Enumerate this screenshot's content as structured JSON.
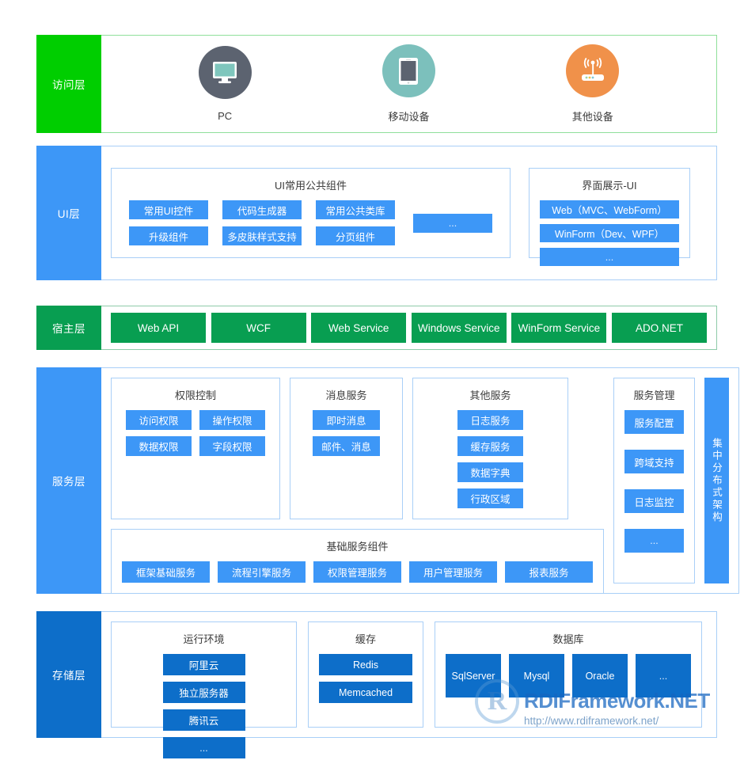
{
  "layers": {
    "access": {
      "label": "访问层",
      "color": "#00ce00",
      "devices": [
        {
          "name": "PC",
          "icon": "desktop-monitor-icon",
          "circle_color": "#5c6370",
          "glyph_color": "#7fc6bd"
        },
        {
          "name": "移动设备",
          "icon": "tablet-device-icon",
          "circle_color": "#7cc0bc",
          "glyph_color": "#5c6370"
        },
        {
          "name": "其他设备",
          "icon": "wireless-router-icon",
          "circle_color": "#f0914a",
          "glyph_color": "#ffffff"
        }
      ]
    },
    "ui": {
      "label": "UI层",
      "color": "#3d97f7",
      "common": {
        "title": "UI常用公共组件",
        "chips": [
          "常用UI控件",
          "代码生成器",
          "常用公共类库",
          "升级组件",
          "多皮肤样式支持",
          "分页组件"
        ],
        "more": "..."
      },
      "display": {
        "title": "界面展示-UI",
        "chips": [
          "Web（MVC、WebForm）",
          "WinForm（Dev、WPF）",
          "..."
        ]
      }
    },
    "host": {
      "label": "宿主层",
      "color": "#089e51",
      "chips": [
        "Web API",
        "WCF",
        "Web Service",
        "Windows Service",
        "WinForm Service",
        "ADO.NET"
      ]
    },
    "service": {
      "label": "服务层",
      "color": "#3d97f7",
      "permission": {
        "title": "权限控制",
        "chips": [
          "访问权限",
          "操作权限",
          "数据权限",
          "字段权限"
        ]
      },
      "message": {
        "title": "消息服务",
        "chips": [
          "即时消息",
          "邮件、消息"
        ]
      },
      "other": {
        "title": "其他服务",
        "chips": [
          "日志服务",
          "缓存服务",
          "数据字典",
          "行政区域"
        ]
      },
      "base": {
        "title": "基础服务组件",
        "chips": [
          "框架基础服务",
          "流程引擎服务",
          "权限管理服务",
          "用户管理服务",
          "报表服务"
        ]
      },
      "management": {
        "title": "服务管理",
        "chips": [
          "服务配置",
          "跨域支持",
          "日志监控",
          "..."
        ]
      },
      "distributed": "集中分布式架构"
    },
    "storage": {
      "label": "存储层",
      "color": "#0d6ec9",
      "runtime": {
        "title": "运行环境",
        "chips": [
          "阿里云",
          "独立服务器",
          "腾讯云",
          "..."
        ]
      },
      "cache": {
        "title": "缓存",
        "chips": [
          "Redis",
          "Memcached"
        ]
      },
      "database": {
        "title": "数据库",
        "chips": [
          "SqlServer",
          "Mysql",
          "Oracle",
          "..."
        ]
      }
    }
  },
  "watermark": {
    "logo_letter": "R",
    "brand": "RDIFramework.NET",
    "url": "http://www.rdiframework.net/"
  }
}
